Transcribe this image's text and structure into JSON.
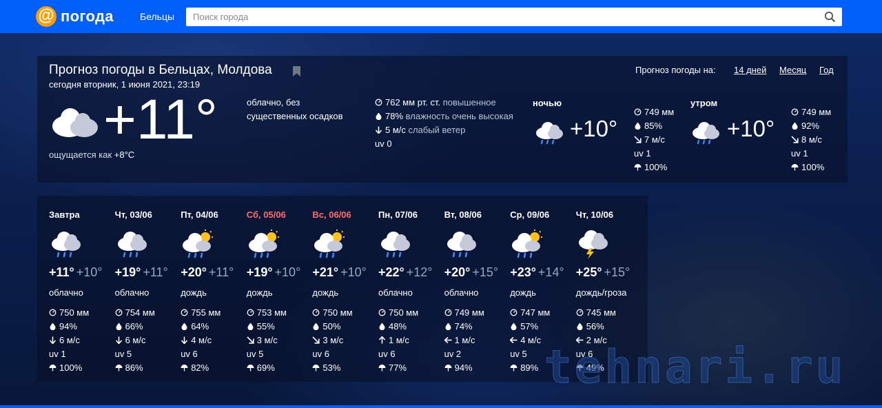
{
  "header": {
    "logo_symbol": "@",
    "logo_text": "погода",
    "city": "Бельцы",
    "search_placeholder": "Поиск города",
    "brand_color": "#005ff9",
    "logo_color": "#ff9e00"
  },
  "current": {
    "title": "Прогноз погоды в Бельцах, Молдова",
    "subtitle": "сегодня вторник, 1 июня 2021, 23:19",
    "temp": "+11°",
    "feels_prefix": "ощущается как ",
    "feels_value": "+8°C",
    "condition": "облачно, без существенных осадков",
    "pressure_value": "762 мм рт. ст.",
    "pressure_desc": "повышенное",
    "humidity_value": "78%",
    "humidity_desc": "влажность очень высокая",
    "wind_value": "5 м/с",
    "wind_desc": "слабый ветер",
    "uv": "uv 0",
    "icon": "cloudy-icon"
  },
  "period": {
    "label": "Прогноз погоды на:",
    "links": [
      "14 дней",
      "Месяц",
      "Год"
    ]
  },
  "parts": [
    {
      "label": "ночью",
      "temp": "+10°",
      "pressure": "749 мм",
      "humidity": "85%",
      "wind": "7 м/с",
      "uv": "uv 1",
      "precip": "100%"
    },
    {
      "label": "утром",
      "temp": "+10°",
      "pressure": "749 мм",
      "humidity": "92%",
      "wind": "8 м/с",
      "uv": "uv 1",
      "precip": "100%"
    }
  ],
  "days": [
    {
      "name": "Завтра",
      "weekend": false,
      "icon": "rain-icon",
      "hi": "+11°",
      "lo": "+10°",
      "cond": "облачно",
      "pressure": "750 мм",
      "humidity": "94%",
      "wind": "6 м/с",
      "wind_dir": "down",
      "uv": "uv 1",
      "precip": "100%"
    },
    {
      "name": "Чт, 03/06",
      "weekend": false,
      "icon": "rain-icon",
      "hi": "+19°",
      "lo": "+11°",
      "cond": "облачно",
      "pressure": "754 мм",
      "humidity": "66%",
      "wind": "6 м/с",
      "wind_dir": "down",
      "uv": "uv 5",
      "precip": "86%"
    },
    {
      "name": "Пт, 04/06",
      "weekend": false,
      "icon": "sun-rain-icon",
      "hi": "+20°",
      "lo": "+11°",
      "cond": "дождь",
      "pressure": "755 мм",
      "humidity": "64%",
      "wind": "4 м/с",
      "wind_dir": "down",
      "uv": "uv 6",
      "precip": "82%"
    },
    {
      "name": "Сб, 05/06",
      "weekend": true,
      "icon": "sun-rain-icon",
      "hi": "+19°",
      "lo": "+10°",
      "cond": "дождь",
      "pressure": "753 мм",
      "humidity": "55%",
      "wind": "3 м/с",
      "wind_dir": "down-right",
      "uv": "uv 5",
      "precip": "69%"
    },
    {
      "name": "Вс, 06/06",
      "weekend": true,
      "icon": "sun-rain-icon",
      "hi": "+21°",
      "lo": "+10°",
      "cond": "дождь",
      "pressure": "750 мм",
      "humidity": "50%",
      "wind": "3 м/с",
      "wind_dir": "down-right",
      "uv": "uv 6",
      "precip": "53%"
    },
    {
      "name": "Пн, 07/06",
      "weekend": false,
      "icon": "rain-icon",
      "hi": "+22°",
      "lo": "+12°",
      "cond": "облачно",
      "pressure": "750 мм",
      "humidity": "48%",
      "wind": "1 м/с",
      "wind_dir": "up",
      "uv": "uv 6",
      "precip": "77%"
    },
    {
      "name": "Вт, 08/06",
      "weekend": false,
      "icon": "rain-icon",
      "hi": "+20°",
      "lo": "+15°",
      "cond": "облачно",
      "pressure": "749 мм",
      "humidity": "74%",
      "wind": "1 м/с",
      "wind_dir": "left",
      "uv": "uv 2",
      "precip": "94%"
    },
    {
      "name": "Ср, 09/06",
      "weekend": false,
      "icon": "sun-rain-icon",
      "hi": "+23°",
      "lo": "+14°",
      "cond": "дождь",
      "pressure": "747 мм",
      "humidity": "57%",
      "wind": "4 м/с",
      "wind_dir": "left",
      "uv": "uv 5",
      "precip": "89%"
    },
    {
      "name": "Чт, 10/06",
      "weekend": false,
      "icon": "thunder-icon",
      "hi": "+25°",
      "lo": "+15°",
      "cond": "дождь/гроза",
      "pressure": "745 мм",
      "humidity": "56%",
      "wind": "2 м/с",
      "wind_dir": "left",
      "uv": "uv 6",
      "precip": "49%"
    }
  ],
  "watermark": "tehnari.ru"
}
